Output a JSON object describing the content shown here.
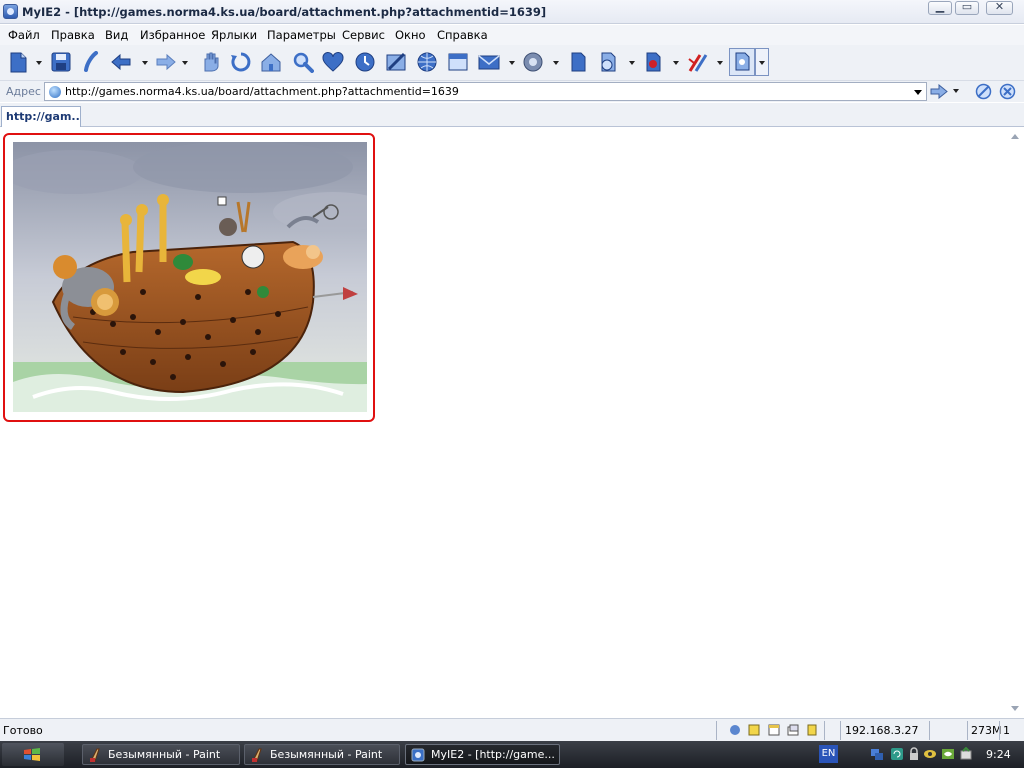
{
  "window": {
    "title": "MyIE2 - [http://games.norma4.ks.ua/board/attachment.php?attachmentid=1639]",
    "controls": {
      "minimize": "▁",
      "maximize": "▭",
      "close": "✕"
    }
  },
  "menu": [
    "Файл",
    "Правка",
    "Вид",
    "Избранное",
    "Ярлыки",
    "Параметры",
    "Сервис",
    "Окно",
    "Справка"
  ],
  "toolbar": {
    "icons": [
      "new-icon",
      "save-icon",
      "phone-icon",
      "back-icon",
      "forward-icon",
      "stop-hand-icon",
      "refresh-icon",
      "home-icon",
      "search-icon",
      "favorites-heart-icon",
      "history-icon",
      "edit-icon",
      "globe-icon",
      "window-icon",
      "mail-icon",
      "media-icon",
      "page-icon",
      "zoom-icon",
      "security-icon",
      "tools-icon",
      "view-icon"
    ]
  },
  "address": {
    "label": "Адрес",
    "url": "http://games.norma4.ks.ua/board/attachment.php?attachmentid=1639"
  },
  "tabs": [
    {
      "label": "http://gam...",
      "active": true
    }
  ],
  "content": {
    "image_alt": "Noah's ark illustration"
  },
  "statusbar": {
    "text": "Готово",
    "ip": "192.168.3.27",
    "memory": "273M",
    "count": "1"
  },
  "taskbar": {
    "tasks": [
      {
        "label": "Безымянный - Paint",
        "active": false
      },
      {
        "label": "Безымянный - Paint",
        "active": false
      },
      {
        "label": "MyIE2 - [http://game...",
        "active": true
      }
    ],
    "language": "EN",
    "clock": "9:24"
  },
  "colors": {
    "image_border": "#e01010",
    "taskbar": "#2a2d33",
    "tab_text": "#1d3a74"
  }
}
